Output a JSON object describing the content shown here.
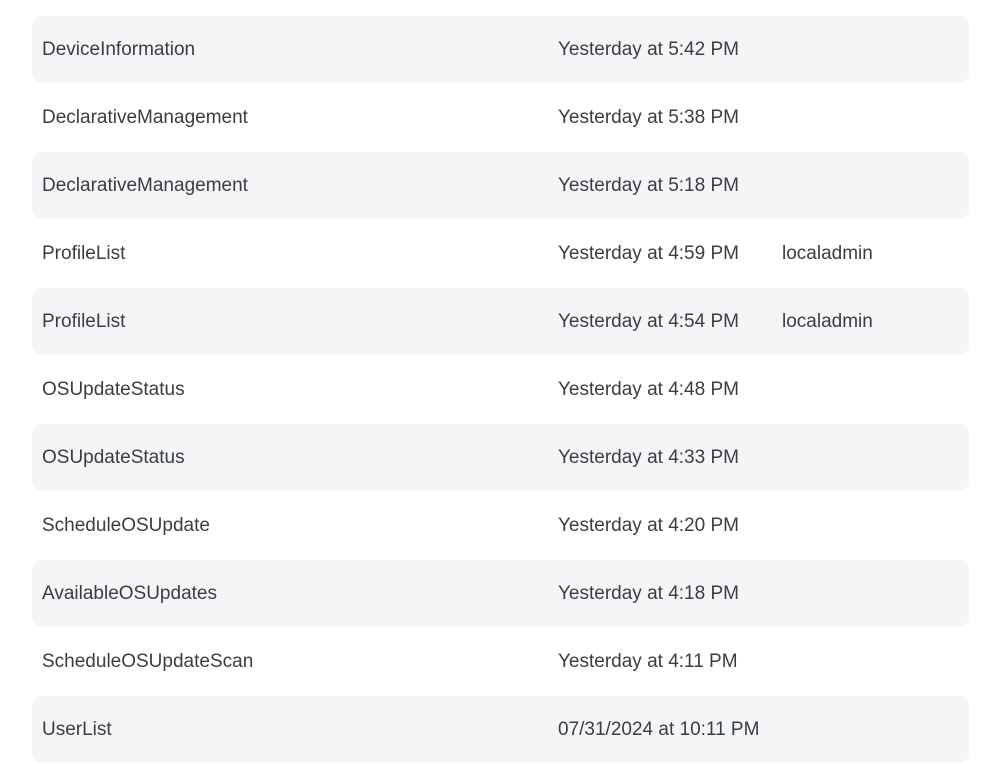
{
  "colors": {
    "row_shaded_bg": "#f4f5f7",
    "row_plain_bg": "#ffffff",
    "text": "#3a3d42"
  },
  "rows": [
    {
      "command": "DeviceInformation",
      "time": "Yesterday at 5:42 PM",
      "user": ""
    },
    {
      "command": "DeclarativeManagement",
      "time": "Yesterday at 5:38 PM",
      "user": ""
    },
    {
      "command": "DeclarativeManagement",
      "time": "Yesterday at 5:18 PM",
      "user": ""
    },
    {
      "command": "ProfileList",
      "time": "Yesterday at 4:59 PM",
      "user": "localadmin"
    },
    {
      "command": "ProfileList",
      "time": "Yesterday at 4:54 PM",
      "user": "localadmin"
    },
    {
      "command": "OSUpdateStatus",
      "time": "Yesterday at 4:48 PM",
      "user": ""
    },
    {
      "command": "OSUpdateStatus",
      "time": "Yesterday at 4:33 PM",
      "user": ""
    },
    {
      "command": "ScheduleOSUpdate",
      "time": "Yesterday at 4:20 PM",
      "user": ""
    },
    {
      "command": "AvailableOSUpdates",
      "time": "Yesterday at 4:18 PM",
      "user": ""
    },
    {
      "command": "ScheduleOSUpdateScan",
      "time": "Yesterday at 4:11 PM",
      "user": ""
    },
    {
      "command": "UserList",
      "time": "07/31/2024 at 10:11 PM",
      "user": ""
    }
  ]
}
